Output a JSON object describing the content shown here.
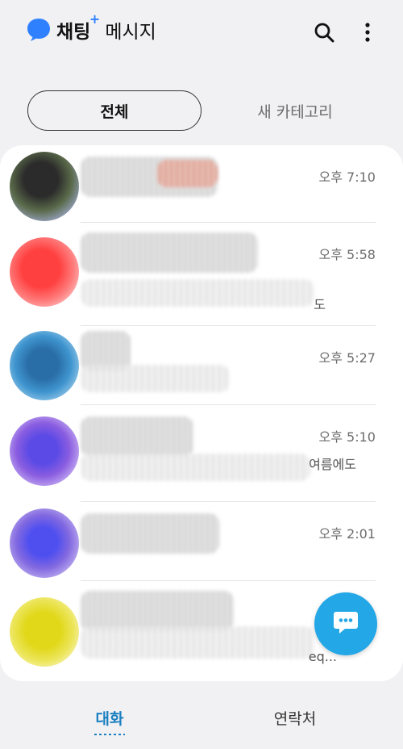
{
  "header": {
    "brand_name": "채팅",
    "brand_plus": "+",
    "title": "메시지",
    "icons": {
      "search": "search-icon",
      "more": "more-vert-icon"
    }
  },
  "tabs": [
    {
      "label": "전체",
      "selected": true
    },
    {
      "label": "새 카테고리",
      "selected": false
    }
  ],
  "conversations": [
    {
      "time": "오후 7:10",
      "snippet": "",
      "avatar_color": "#3d4a3a"
    },
    {
      "time": "오후 5:58",
      "snippet": "도",
      "avatar_color": "#ff5a5a"
    },
    {
      "time": "오후 5:27",
      "snippet": "",
      "avatar_color": "#2f86c4"
    },
    {
      "time": "오후 5:10",
      "snippet": "여름에도",
      "avatar_color": "#7a55e0"
    },
    {
      "time": "오후 2:01",
      "snippet": "",
      "avatar_color": "#6a5ce6"
    },
    {
      "time": "",
      "snippet": "eq...",
      "avatar_color": "#e8e22a"
    }
  ],
  "fab": {
    "icon": "chat-bubble-icon",
    "color": "#23a7e6"
  },
  "bottom_nav": {
    "chats": "대화",
    "contacts": "연락처"
  }
}
